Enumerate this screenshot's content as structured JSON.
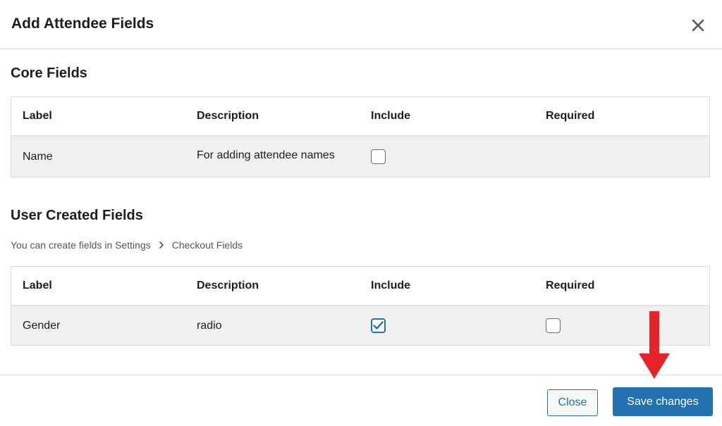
{
  "modal": {
    "title": "Add Attendee Fields"
  },
  "core_fields": {
    "title": "Core Fields",
    "columns": [
      "Label",
      "Description",
      "Include",
      "Required"
    ],
    "rows": [
      {
        "label": "Name",
        "description": "For adding attendee names",
        "include": false
      }
    ]
  },
  "user_fields": {
    "title": "User Created Fields",
    "breadcrumb": [
      "You can create fields in Settings",
      "Checkout Fields"
    ],
    "columns": [
      "Label",
      "Description",
      "Include",
      "Required"
    ],
    "rows": [
      {
        "label": "Gender",
        "description": "radio",
        "include": true,
        "required": false
      }
    ]
  },
  "footer": {
    "close_label": "Close",
    "save_label": "Save changes"
  },
  "colors": {
    "accent": "#2271b1",
    "annotation_arrow": "#e5242a"
  }
}
